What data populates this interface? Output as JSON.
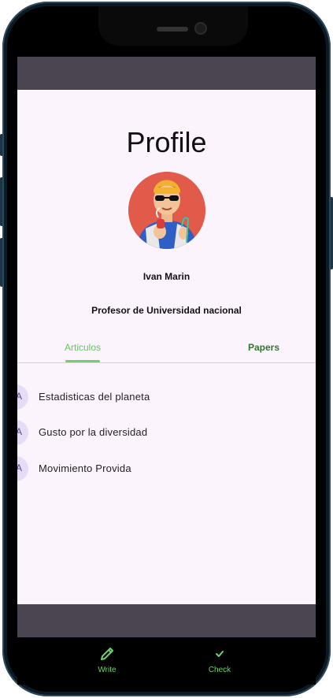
{
  "screen": {
    "title": "Profile",
    "user": {
      "name": "Ivan Marin",
      "role": "Profesor de  Universidad nacional"
    },
    "tabs": [
      {
        "label": "Articulos",
        "selected": true
      },
      {
        "label": "Papers",
        "selected": false
      }
    ],
    "articles": [
      {
        "avatar_letter": "A",
        "title": "Estadisticas del planeta"
      },
      {
        "avatar_letter": "A",
        "title": "Gusto por la diversidad"
      },
      {
        "avatar_letter": "A",
        "title": "Movimiento Provida"
      }
    ]
  },
  "nav": {
    "items": [
      {
        "label": "Write",
        "icon": "pencil-icon"
      },
      {
        "label": "Check",
        "icon": "check-icon"
      }
    ]
  },
  "colors": {
    "accent": "#6bd36b",
    "background": "#fcf4fc",
    "appbar": "#4a4550",
    "avatar_bg": "#e25a4a",
    "list_avatar_bg": "#e6dcf7"
  }
}
